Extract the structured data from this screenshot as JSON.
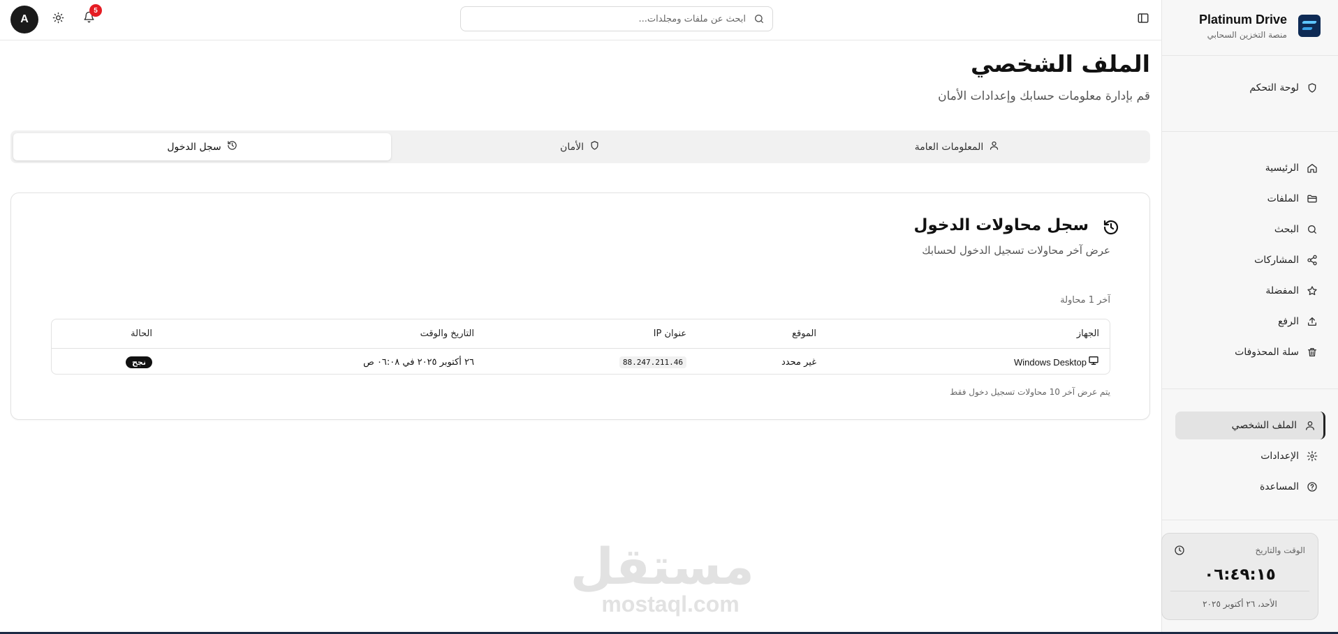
{
  "brand": {
    "name": "Platinum Drive",
    "subtitle": "منصة التخزين السحابي"
  },
  "sidebar": {
    "dashboard": {
      "label": "لوحة التحكم",
      "icon": "shield-icon"
    },
    "items": [
      {
        "label": "الرئيسية",
        "icon": "home-icon"
      },
      {
        "label": "الملفات",
        "icon": "folder-icon"
      },
      {
        "label": "البحث",
        "icon": "search-icon"
      },
      {
        "label": "المشاركات",
        "icon": "share-icon"
      },
      {
        "label": "المفضلة",
        "icon": "star-icon"
      },
      {
        "label": "الرفع",
        "icon": "upload-icon"
      },
      {
        "label": "سلة المحذوفات",
        "icon": "trash-icon"
      }
    ],
    "bottom_items": [
      {
        "label": "الملف الشخصي",
        "icon": "user-icon",
        "active": true
      },
      {
        "label": "الإعدادات",
        "icon": "gear-icon"
      },
      {
        "label": "المساعدة",
        "icon": "help-icon"
      }
    ],
    "clock": {
      "title": "الوقت والتاريخ",
      "time": "٠٦:٤٩:١٥",
      "date": "الأحد، ٢٦ أكتوبر ٢٠٢٥"
    }
  },
  "topbar": {
    "search_placeholder": "ابحث عن ملفات ومجلدات...",
    "avatar_initial": "A",
    "notification_count": "5"
  },
  "page": {
    "title": "الملف الشخصي",
    "subtitle": "قم بإدارة معلومات حسابك وإعدادات الأمان"
  },
  "tabs": [
    {
      "label": "المعلومات العامة",
      "icon": "user-icon"
    },
    {
      "label": "الأمان",
      "icon": "shield-icon"
    },
    {
      "label": "سجل الدخول",
      "icon": "history-icon",
      "active": true
    }
  ],
  "login_history": {
    "title": "سجل محاولات الدخول",
    "description": "عرض آخر محاولات تسجيل الدخول لحسابك",
    "count_text": "آخر 1 محاولة",
    "columns": [
      "الجهاز",
      "الموقع",
      "عنوان IP",
      "التاريخ والوقت",
      "الحالة"
    ],
    "rows": [
      {
        "device": "Windows Desktop",
        "location": "غير محدد",
        "ip": "88.247.211.46",
        "datetime": "٢٦ أكتوبر ٢٠٢٥ في ٠٦:٠٨ ص",
        "status": "نجح"
      }
    ],
    "note": "يتم عرض آخر 10 محاولات تسجيل دخول فقط"
  },
  "watermark": {
    "arabic": "مستقل",
    "latin": "mostaql.com"
  },
  "colors": {
    "accent": "#111111",
    "badge": "#e51c23",
    "brand_logo": "#0e2b55",
    "status_success_bg": "#111111"
  }
}
